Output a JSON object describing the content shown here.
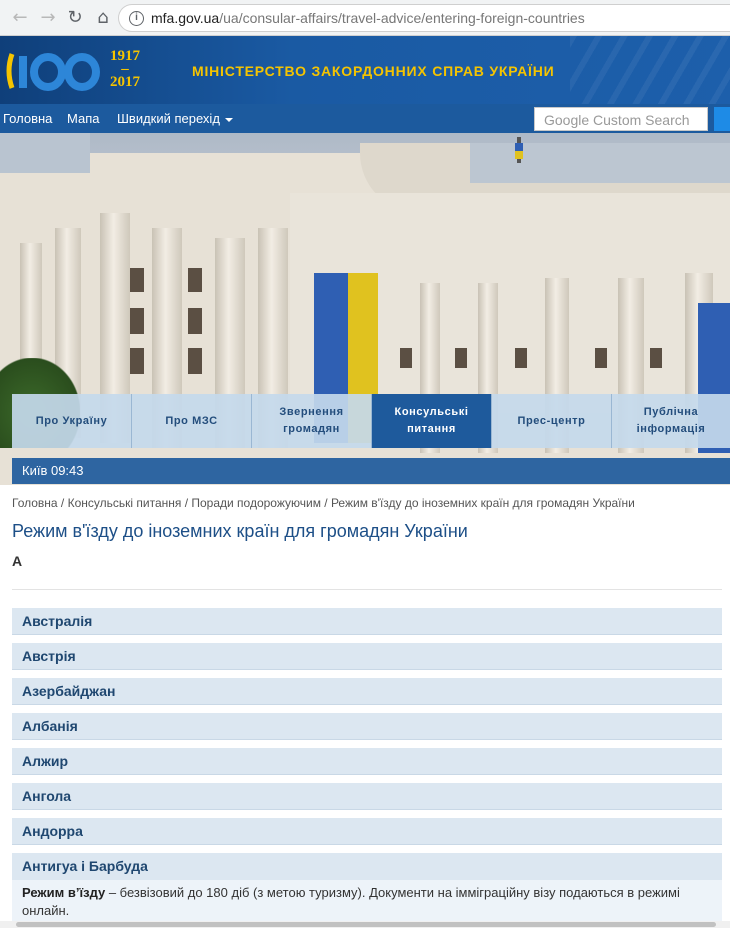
{
  "browser": {
    "url_host": "mfa.gov.ua",
    "url_path": "/ua/consular-affairs/travel-advice/entering-foreign-countries",
    "back_icon": "←",
    "forward_icon": "→",
    "reload_icon": "↻",
    "home_icon": "⌂",
    "info_icon": "i"
  },
  "header": {
    "logo_text": "100",
    "year_start": "1917",
    "year_dash": "–",
    "year_end": "2017",
    "title": "МІНІСТЕРСТВО ЗАКОРДОННИХ СПРАВ УКРАЇНИ"
  },
  "topnav": {
    "home": "Головна",
    "map": "Мапа",
    "quick": "Швидкий перехід",
    "search_placeholder": "Google Custom Search"
  },
  "tabs": [
    {
      "label": "Про Україну"
    },
    {
      "label": "Про МЗС"
    },
    {
      "label": "Звернення громадян"
    },
    {
      "label": "Консульські питання"
    },
    {
      "label": "Прес-центр"
    },
    {
      "label": "Публічна інформація"
    }
  ],
  "time_bar": "Київ 09:43",
  "breadcrumb": "Головна / Консульські питання / Поради подорожуючим / Режим в'їзду до іноземних країн для громадян України",
  "page_title": "Режим в'їзду до іноземних країн для громадян України",
  "letter": "А",
  "countries": [
    "Австралія",
    "Австрія",
    "Азербайджан",
    "Албанія",
    "Алжир",
    "Ангола",
    "Андорра"
  ],
  "expanded": {
    "name": "Антигуа і Барбуда",
    "label": "Режим в’їзду",
    "text": " – безвізовий до 180 діб (з метою туризму). Документи на імміграційну візу подаються в режимі онлайн."
  },
  "colors": {
    "header_blue": "#1a5aa3",
    "gold": "#f5c400",
    "tab_active": "#1e5a9c",
    "accordion": "#dce7f1"
  }
}
